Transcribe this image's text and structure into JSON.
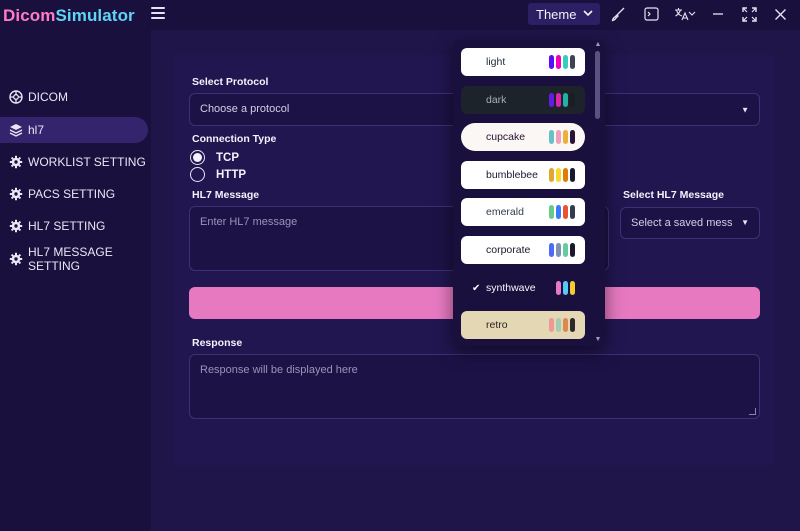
{
  "app": {
    "title_part1": "Dicom",
    "title_part2": "Simulator"
  },
  "toolbar": {
    "theme_label": "Theme",
    "icons": [
      "paintbrush-icon",
      "terminal-icon",
      "translate-icon",
      "chevron-down-icon",
      "minimize-icon",
      "maximize-icon",
      "close-icon"
    ]
  },
  "sidebar": {
    "items": [
      {
        "label": "DICOM",
        "icon": "dicom-icon",
        "active": false
      },
      {
        "label": "hl7",
        "icon": "layers-icon",
        "active": true
      },
      {
        "label": "WORKLIST SETTING",
        "icon": "gear-icon",
        "active": false
      },
      {
        "label": "PACS SETTING",
        "icon": "gear-icon",
        "active": false
      },
      {
        "label": "HL7 SETTING",
        "icon": "gear-icon",
        "active": false
      },
      {
        "label": "HL7 MESSAGE SETTING",
        "icon": "gear-icon",
        "active": false
      }
    ]
  },
  "form": {
    "protocol_label": "Select Protocol",
    "protocol_value": "Choose a protocol",
    "connection_label": "Connection Type",
    "connection_options": [
      {
        "label": "TCP",
        "selected": true
      },
      {
        "label": "HTTP",
        "selected": false
      }
    ],
    "message_label": "HL7 Message",
    "message_placeholder": "Enter HL7 message",
    "saved_label": "Select HL7 Message",
    "saved_value": "Select a saved messa",
    "response_label": "Response",
    "response_placeholder": "Response will be displayed here"
  },
  "theme_menu": {
    "items": [
      {
        "name": "light",
        "bg": "#ffffff",
        "fg": "#1f2937",
        "colors": [
          "#570df8",
          "#f000b8",
          "#37cdbe",
          "#3d4451"
        ],
        "selected": false
      },
      {
        "name": "dark",
        "bg": "#1d232a",
        "fg": "#a6adbb",
        "colors": [
          "#661ae6",
          "#d926aa",
          "#1fb2a5",
          "#191d24"
        ],
        "selected": false
      },
      {
        "name": "cupcake",
        "bg": "#faf7f5",
        "fg": "#291334",
        "colors": [
          "#65c3c8",
          "#ef9fbc",
          "#eeaf3a",
          "#291334"
        ],
        "selected": false
      },
      {
        "name": "bumblebee",
        "bg": "#ffffff",
        "fg": "#181830",
        "colors": [
          "#e0a82e",
          "#f9d72f",
          "#df7e07",
          "#181830"
        ],
        "selected": false
      },
      {
        "name": "emerald",
        "bg": "#ffffff",
        "fg": "#333c4d",
        "colors": [
          "#66cc8a",
          "#377cfb",
          "#ea5234",
          "#333c4d"
        ],
        "selected": false
      },
      {
        "name": "corporate",
        "bg": "#ffffff",
        "fg": "#181a2a",
        "colors": [
          "#4b6bfb",
          "#7b92b2",
          "#67cba0",
          "#181a2a"
        ],
        "selected": false
      },
      {
        "name": "synthwave",
        "bg": "#1a103d",
        "fg": "#f9f7fd",
        "colors": [
          "#e779c1",
          "#58c7f3",
          "#f3cc30"
        ],
        "selected": true
      },
      {
        "name": "retro",
        "bg": "#e4d8b4",
        "fg": "#282425",
        "colors": [
          "#ef9995",
          "#a4cbb4",
          "#dc8850",
          "#2e282a"
        ],
        "selected": false
      }
    ]
  }
}
